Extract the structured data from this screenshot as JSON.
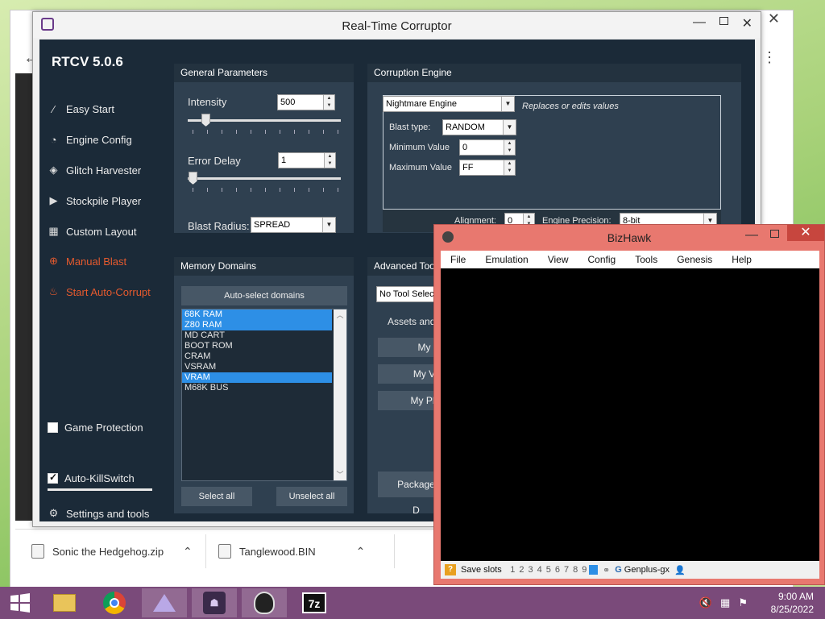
{
  "rtcv": {
    "title": "Real-Time Corruptor",
    "brand": "RTCV 5.0.6",
    "nav": [
      {
        "label": "Easy Start",
        "icon": "magic-wand-icon"
      },
      {
        "label": "Engine Config",
        "icon": "gauge-icon"
      },
      {
        "label": "Glitch Harvester",
        "icon": "layers-icon"
      },
      {
        "label": "Stockpile Player",
        "icon": "play-icon"
      },
      {
        "label": "Custom Layout",
        "icon": "grid-icon"
      },
      {
        "label": "Manual Blast",
        "icon": "crosshair-icon"
      },
      {
        "label": "Start Auto-Corrupt",
        "icon": "flame-icon"
      }
    ],
    "game_protection": {
      "label": "Game Protection",
      "checked": false
    },
    "auto_killswitch": {
      "label": "Auto-KillSwitch",
      "checked": true
    },
    "settings_label": "Settings and tools",
    "general": {
      "header": "General Parameters",
      "intensity_label": "Intensity",
      "intensity_value": "500",
      "intensity_slider_fraction": 0.1,
      "error_delay_label": "Error Delay",
      "error_delay_value": "1",
      "error_delay_slider_fraction": 0.0,
      "blast_radius_label": "Blast Radius:",
      "blast_radius_value": "SPREAD"
    },
    "engine": {
      "header": "Corruption Engine",
      "engine_value": "Nightmare Engine",
      "engine_desc": "Replaces or edits values",
      "blast_type_label": "Blast type:",
      "blast_type_value": "RANDOM",
      "min_label": "Minimum Value",
      "min_value": "0",
      "max_label": "Maximum Value",
      "max_value": "FF",
      "alignment_label": "Alignment:",
      "alignment_value": "0",
      "precision_label": "Engine Precision:",
      "precision_value": "8-bit"
    },
    "memory": {
      "header": "Memory Domains",
      "auto_select": "Auto-select domains",
      "domains": [
        {
          "name": "68K RAM",
          "selected": true
        },
        {
          "name": "Z80 RAM",
          "selected": true
        },
        {
          "name": "MD CART",
          "selected": false
        },
        {
          "name": "BOOT ROM",
          "selected": false
        },
        {
          "name": "CRAM",
          "selected": false
        },
        {
          "name": "VSRAM",
          "selected": false
        },
        {
          "name": "VRAM",
          "selected": true
        },
        {
          "name": "M68K BUS",
          "selected": false
        }
      ],
      "select_all": "Select all",
      "unselect_all": "Unselect all"
    },
    "advanced": {
      "header": "Advanced Too",
      "tool_select": "No Tool Selec",
      "assets_label": "Assets and",
      "btn1": "My",
      "btn2": "My V",
      "btn3": "My Pl",
      "package": "Package D"
    }
  },
  "bizhawk": {
    "title": "BizHawk",
    "menu": [
      "File",
      "Emulation",
      "View",
      "Config",
      "Tools",
      "Genesis",
      "Help"
    ],
    "save_slots_label": "Save slots",
    "slots": [
      "1",
      "2",
      "3",
      "4",
      "5",
      "6",
      "7",
      "8",
      "9",
      "0"
    ],
    "selected_slot": "0",
    "core": "Genplus-gx"
  },
  "downloads": [
    {
      "name": "Sonic the Hedgehog.zip"
    },
    {
      "name": "Tanglewood.BIN"
    }
  ],
  "taskbar": {
    "time": "9:00 AM",
    "date": "8/25/2022",
    "apps": [
      "file-explorer-icon",
      "chrome-icon",
      "app-icon",
      "rtcv-icon",
      "bizhawk-icon",
      "7zip-icon"
    ]
  }
}
